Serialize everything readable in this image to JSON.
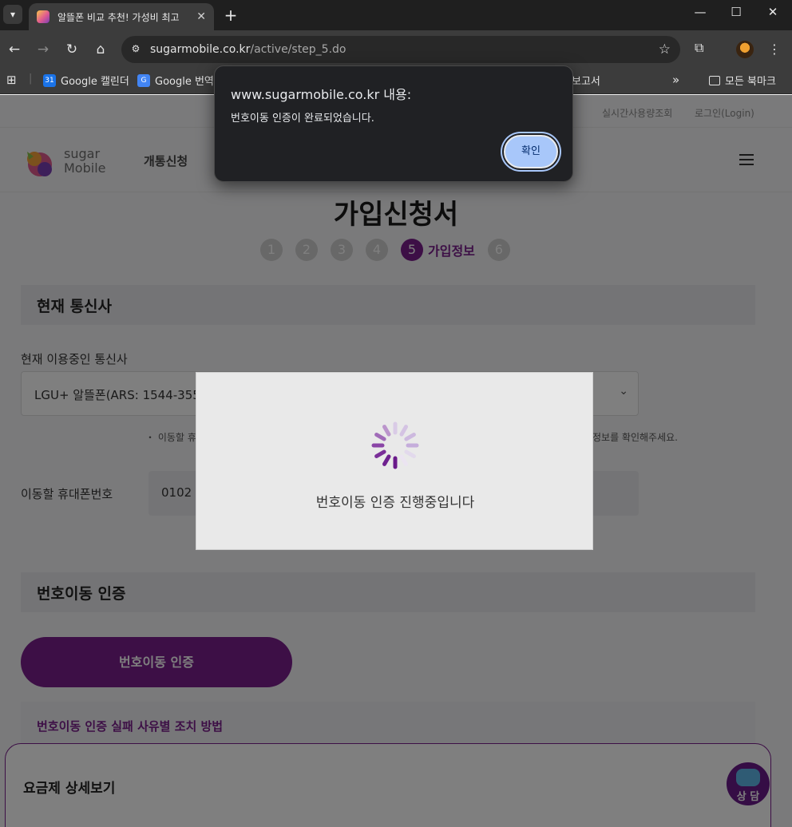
{
  "browser": {
    "tab_title": "알뜰폰 비교 추천! 가성비 최고",
    "url_domain": "sugarmobile.co.kr",
    "url_path": "/active/step_5.do",
    "bookmarks": {
      "calendar": "Google 캘린더",
      "translate": "Google 번역",
      "report": "보고서",
      "more": "»",
      "all_bookmarks": "모든 북마크"
    },
    "icons": {
      "menu": "▾",
      "close": "✕",
      "new_tab": "+",
      "minimize": "—",
      "maximize": "☐",
      "back": "←",
      "forward": "→",
      "reload": "↻",
      "home": "⌂",
      "star": "☆",
      "extensions": "⧉",
      "kebab": "⋮",
      "apps": "⊞"
    }
  },
  "site": {
    "util_links": [
      "실시간사용량조회",
      "로그인(Login)"
    ],
    "logo_line1": "sugar",
    "logo_line2": "Mobile",
    "gnb_first": "개통신청",
    "page_title": "가입신청서",
    "steps": [
      "1",
      "2",
      "3",
      "4",
      "5",
      "6"
    ],
    "active_step_label": "가입정보",
    "section_carrier": "현재 통신사",
    "carrier_label": "현재 이용중인 통신사",
    "carrier_value": "LGU+ 알뜰폰(ARS: 1544-355",
    "note_left": "・ 이동할 휴",
    "note_right": "정보를 확인해주세요.",
    "phone_label": "이동할 휴대폰번호",
    "phone_value": "0102",
    "section_verify": "번호이동 인증",
    "verify_button": "번호이동 인증",
    "fail_link": "번호이동 인증 실패 사유별 조치 방법",
    "plan_detail": "요금제 상세보기",
    "chat_label": "상 담"
  },
  "loading": {
    "text": "번호이동 인증 진행중입니다"
  },
  "alert": {
    "title": "www.sugarmobile.co.kr 내용:",
    "message": "번호이동 인증이 완료되었습니다.",
    "ok_label": "확인"
  },
  "colors": {
    "brand": "#7a1e8c",
    "alert_button": "#a8c7fa"
  }
}
